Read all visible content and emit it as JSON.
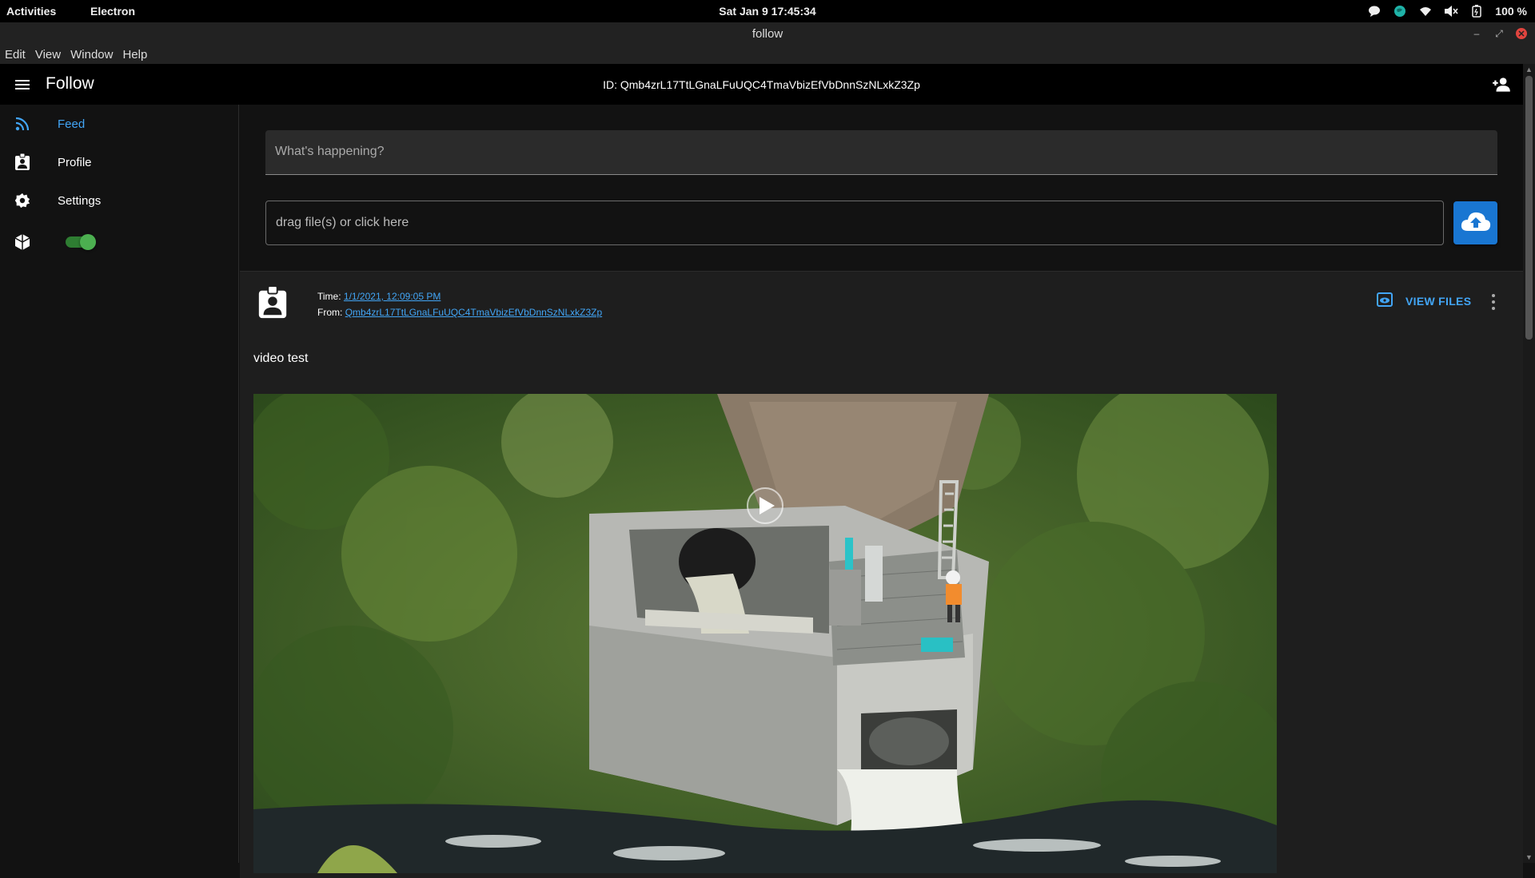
{
  "system_bar": {
    "activities": "Activities",
    "app_name": "Electron",
    "clock": "Sat Jan 9  17:45:34",
    "battery": "100 %",
    "icons": [
      "chat-icon",
      "globe-icon",
      "wifi-icon",
      "volume-muted-icon",
      "battery-icon"
    ]
  },
  "window": {
    "title": "follow",
    "controls": [
      "minimize-icon",
      "maximize-icon",
      "close-icon"
    ]
  },
  "menu": [
    "Edit",
    "View",
    "Window",
    "Help"
  ],
  "appbar": {
    "title": "Follow",
    "id_label": "ID: Qmb4zrL17TtLGnaLFuUQC4TmaVbizEfVbDnnSzNLxkZ3Zp",
    "icons": [
      "hamburger-menu-icon",
      "add-person-icon"
    ]
  },
  "sidebar": {
    "items": [
      {
        "label": "Feed",
        "icon": "rss-feed-icon",
        "active": true
      },
      {
        "label": "Profile",
        "icon": "profile-badge-icon",
        "active": false
      },
      {
        "label": "Settings",
        "icon": "gear-icon",
        "active": false
      }
    ],
    "toggle": {
      "icon": "ipfs-cube-icon",
      "on": true
    }
  },
  "composer": {
    "post_placeholder": "What's happening?",
    "file_placeholder": "drag file(s) or click here",
    "upload_icon": "cloud-upload-icon"
  },
  "post": {
    "time_label": "Time:",
    "time_value": "1/1/2021, 12:09:05 PM",
    "from_label": "From:",
    "from_value": "Qmb4zrL17TtLGnaLFuUQC4TmaVbizEfVbDnnSzNLxkZ3Zp",
    "view_files_label": "VIEW FILES",
    "text": "video test",
    "media": "video of aerial view of concrete weir outflow structure with worker"
  },
  "colors": {
    "accent": "#42a5f5",
    "button": "#1976d2",
    "toggle": "#4caf50",
    "background": "#121212"
  }
}
